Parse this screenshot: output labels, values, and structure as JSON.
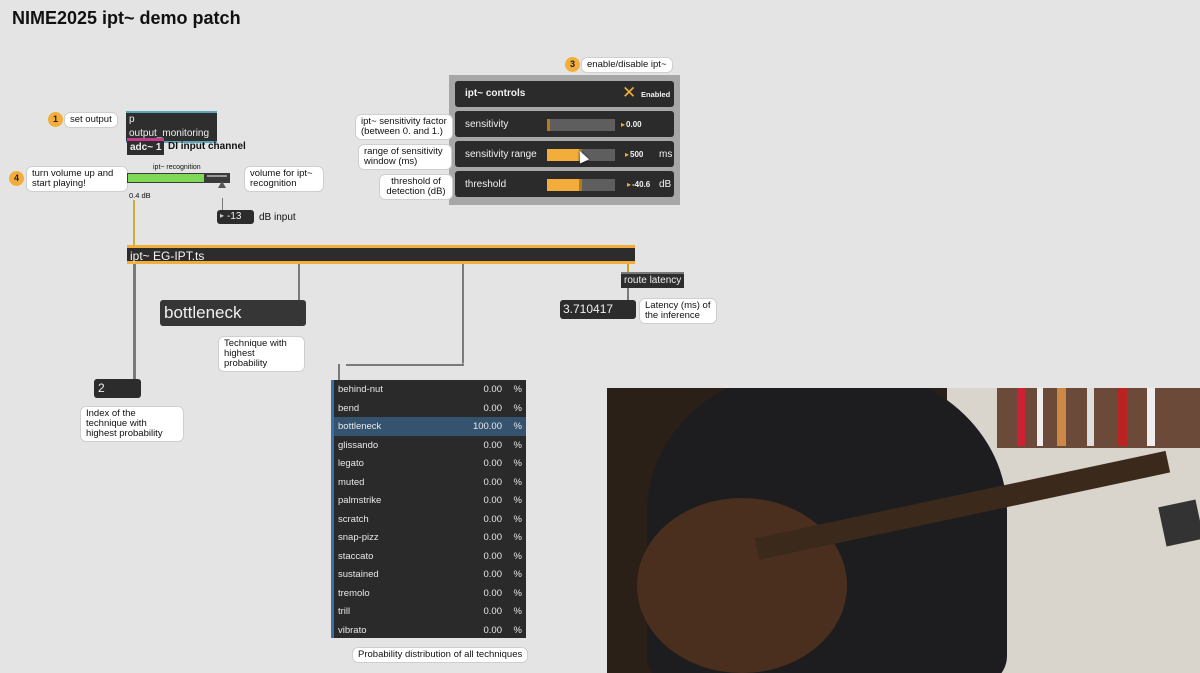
{
  "title": "NIME2025 ipt~ demo patch",
  "steps": [
    {
      "n": "1",
      "text": "set output"
    },
    {
      "n": "3",
      "text": "enable/disable ipt~"
    },
    {
      "n": "4",
      "text": "turn volume up and start playing!"
    }
  ],
  "objects": {
    "output_monitoring": "p output_monitoring",
    "adc": "adc~ 1",
    "di_label": "DI input channel",
    "meter_label": "ipt~ recognition",
    "volume_comment": "volume for ipt~ recognition",
    "meter_db": "0.4 dB",
    "db_input_value": "-13",
    "db_input_label": "dB input",
    "ipt_object": "ipt~ EG-IPT.ts",
    "route_latency": "route latency",
    "latency_value": "3.710417",
    "latency_comment": "Latency (ms) of the inference",
    "technique_display": "bottleneck",
    "technique_comment": "Technique with highest probability",
    "index_value": "2",
    "index_comment": "Index of the technique with highest probability",
    "prob_comment": "Probability distribution of all techniques"
  },
  "controls": {
    "title": "ipt~ controls",
    "enabled_label": "Enabled",
    "enable_icon": "x-toggle-icon",
    "sensitivity": {
      "label": "sensitivity",
      "value": "0.00",
      "level": 0.0,
      "comment": "ipt~ sensitivity factor (between 0. and 1.)"
    },
    "sensitivity_range": {
      "label": "sensitivity range",
      "value": "500",
      "unit": "ms",
      "level": 0.5,
      "comment": "range of sensitivity window (ms)"
    },
    "threshold": {
      "label": "threshold",
      "value": "-40.6",
      "unit": "dB",
      "level": 0.5,
      "comment": "threshold of detection (dB)"
    }
  },
  "techniques": [
    {
      "name": "behind-nut",
      "value": "0.00",
      "unit": "%"
    },
    {
      "name": "bend",
      "value": "0.00",
      "unit": "%"
    },
    {
      "name": "bottleneck",
      "value": "100.00",
      "unit": "%"
    },
    {
      "name": "glissando",
      "value": "0.00",
      "unit": "%"
    },
    {
      "name": "legato",
      "value": "0.00",
      "unit": "%"
    },
    {
      "name": "muted",
      "value": "0.00",
      "unit": "%"
    },
    {
      "name": "palmstrike",
      "value": "0.00",
      "unit": "%"
    },
    {
      "name": "scratch",
      "value": "0.00",
      "unit": "%"
    },
    {
      "name": "snap-pizz",
      "value": "0.00",
      "unit": "%"
    },
    {
      "name": "staccato",
      "value": "0.00",
      "unit": "%"
    },
    {
      "name": "sustained",
      "value": "0.00",
      "unit": "%"
    },
    {
      "name": "tremolo",
      "value": "0.00",
      "unit": "%"
    },
    {
      "name": "trill",
      "value": "0.00",
      "unit": "%"
    },
    {
      "name": "vibrato",
      "value": "0.00",
      "unit": "%"
    }
  ],
  "colors": {
    "accent": "#f3ad3b",
    "adc": "#c43a8c",
    "meter": "#7ed957",
    "selection": "#35536f"
  }
}
